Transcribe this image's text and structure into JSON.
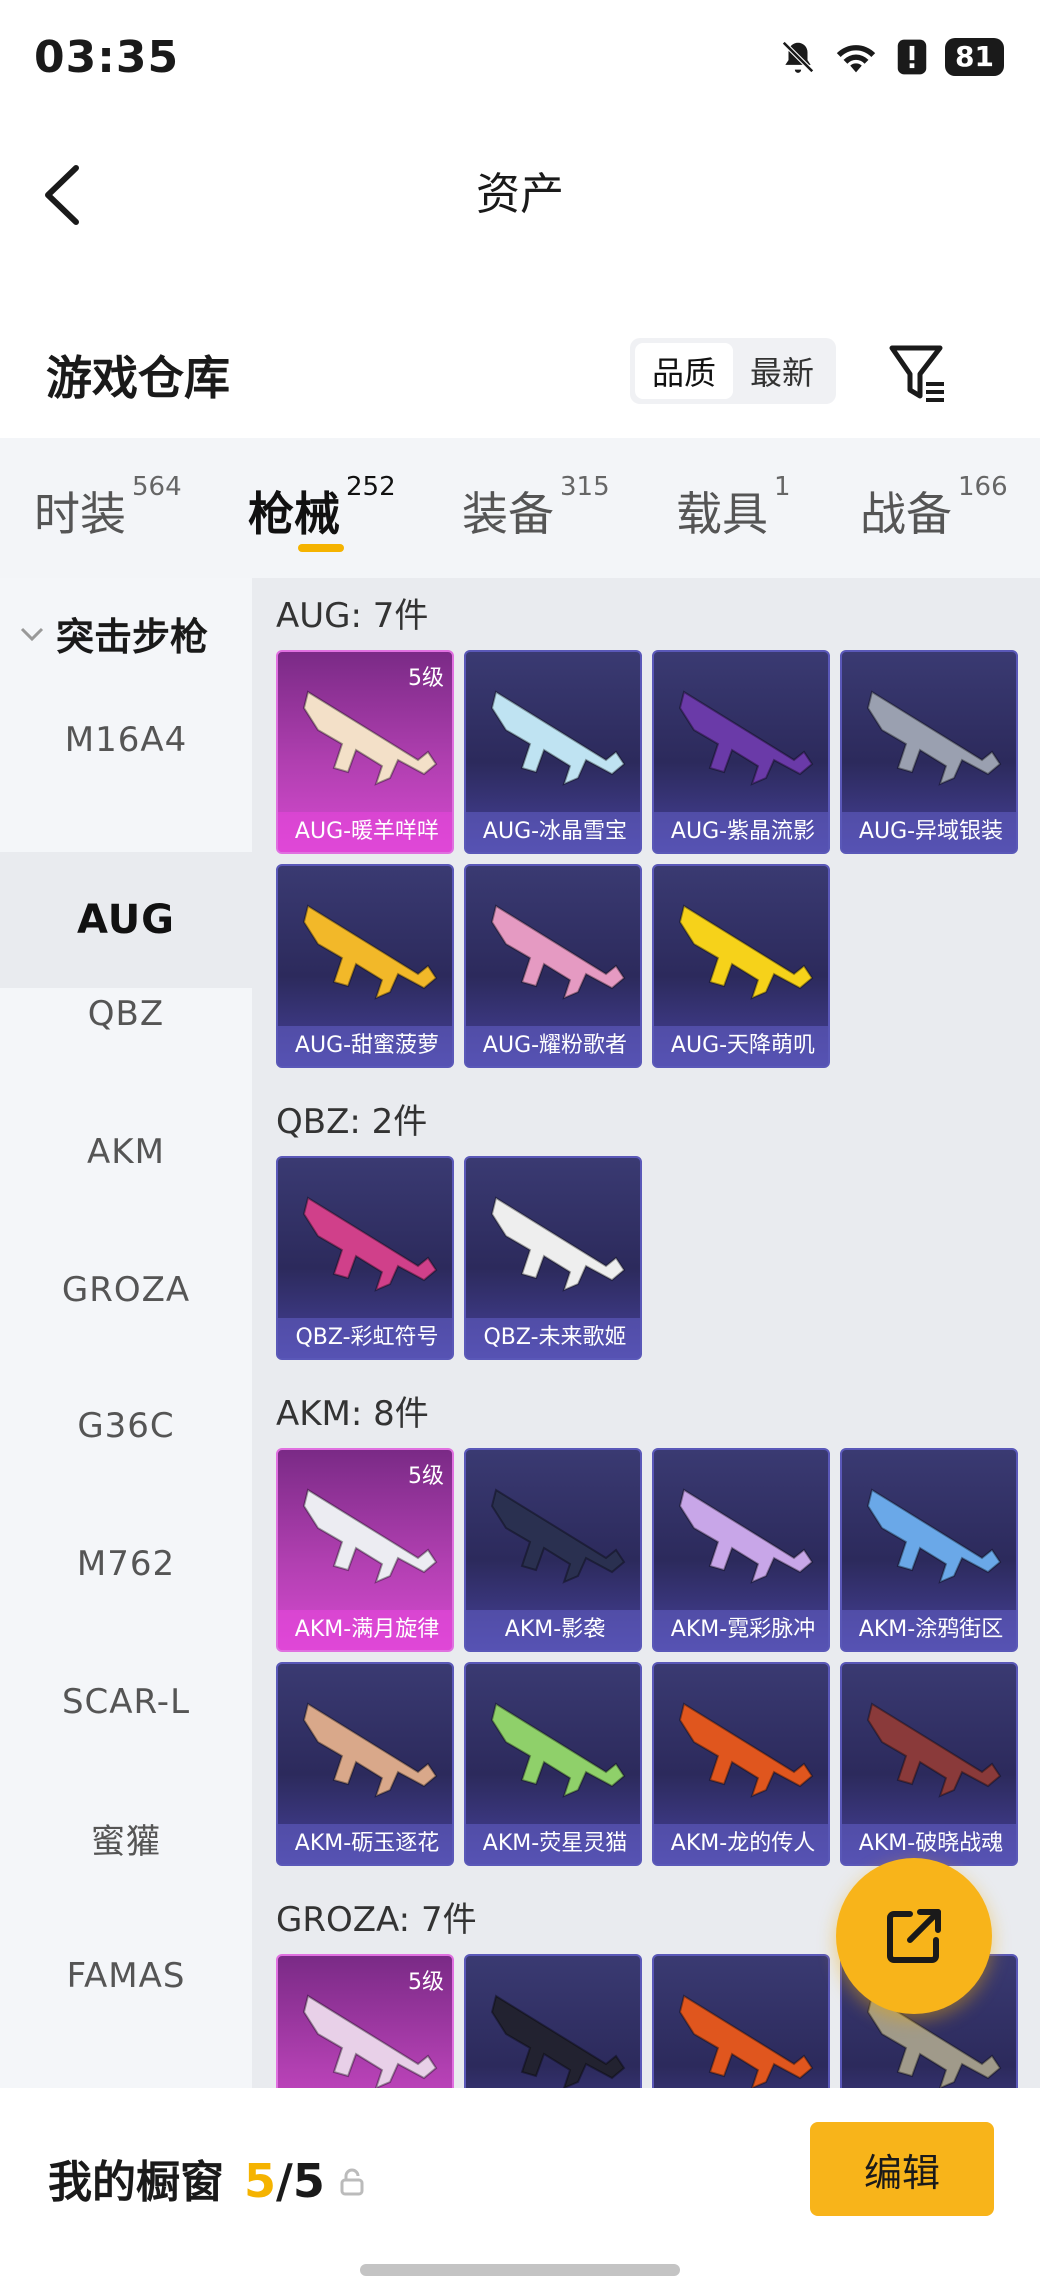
{
  "status": {
    "time": "03:35",
    "battery": "81"
  },
  "header": {
    "title": "资产"
  },
  "warehouse": {
    "title": "游戏仓库",
    "sort": [
      "品质",
      "最新"
    ]
  },
  "tabs": [
    {
      "label": "时装",
      "count": "564"
    },
    {
      "label": "枪械",
      "count": "252"
    },
    {
      "label": "装备",
      "count": "315"
    },
    {
      "label": "载具",
      "count": "1"
    },
    {
      "label": "战备",
      "count": "166"
    }
  ],
  "sidebar": {
    "category": "突击步枪",
    "items": [
      "M16A4",
      "AUG",
      "QBZ",
      "AKM",
      "GROZA",
      "G36C",
      "M762",
      "SCAR-L",
      "蜜獾",
      "FAMAS"
    ]
  },
  "groups": [
    {
      "title": "AUG: 7件",
      "items": [
        {
          "name": "AUG-暖羊咩咩",
          "level": "5级",
          "rarity": "gold",
          "color": "#f3e0c8"
        },
        {
          "name": "AUG-冰晶雪宝",
          "rarity": "purple",
          "color": "#bfe3f2"
        },
        {
          "name": "AUG-紫晶流影",
          "rarity": "purple",
          "color": "#6a3aa8"
        },
        {
          "name": "AUG-异域银装",
          "rarity": "purple",
          "color": "#9aa0b0"
        },
        {
          "name": "AUG-甜蜜菠萝",
          "rarity": "purple",
          "color": "#f2b829"
        },
        {
          "name": "AUG-耀粉歌者",
          "rarity": "purple",
          "color": "#e59ac2"
        },
        {
          "name": "AUG-天降萌叽",
          "rarity": "purple",
          "color": "#f6d21a"
        }
      ]
    },
    {
      "title": "QBZ: 2件",
      "items": [
        {
          "name": "QBZ-彩虹符号",
          "rarity": "purple",
          "color": "#d0408a"
        },
        {
          "name": "QBZ-未来歌姬",
          "rarity": "purple",
          "color": "#eeeeee"
        }
      ]
    },
    {
      "title": "AKM: 8件",
      "items": [
        {
          "name": "AKM-满月旋律",
          "level": "5级",
          "rarity": "gold",
          "color": "#ececf2"
        },
        {
          "name": "AKM-影袭",
          "rarity": "purple",
          "color": "#2a3050"
        },
        {
          "name": "AKM-霓彩脉冲",
          "rarity": "purple",
          "color": "#c8a6e8"
        },
        {
          "name": "AKM-涂鸦街区",
          "rarity": "purple",
          "color": "#6aa8e8"
        },
        {
          "name": "AKM-砺玉逐花",
          "rarity": "purple",
          "color": "#d9a88a"
        },
        {
          "name": "AKM-荧星灵猫",
          "rarity": "purple",
          "color": "#8fd06a"
        },
        {
          "name": "AKM-龙的传人",
          "rarity": "purple",
          "color": "#e0561e"
        },
        {
          "name": "AKM-破晓战魂",
          "rarity": "purple",
          "color": "#8a3a3a"
        }
      ]
    },
    {
      "title": "GROZA: 7件",
      "items": [
        {
          "name": "",
          "level": "5级",
          "rarity": "gold",
          "color": "#e8d0e8"
        },
        {
          "name": "",
          "rarity": "purple",
          "color": "#222230"
        },
        {
          "name": "",
          "rarity": "purple",
          "color": "#e0561e"
        },
        {
          "name": "",
          "rarity": "purple",
          "color": "#a09a8a"
        }
      ]
    }
  ],
  "showcase": {
    "title": "我的橱窗",
    "count_current": "5",
    "count_total": "/5",
    "edit_label": "编辑"
  },
  "colors": {
    "accent": "#f8b41a",
    "gold_card": "#c64ac4",
    "purple_card": "#3a3a72"
  }
}
